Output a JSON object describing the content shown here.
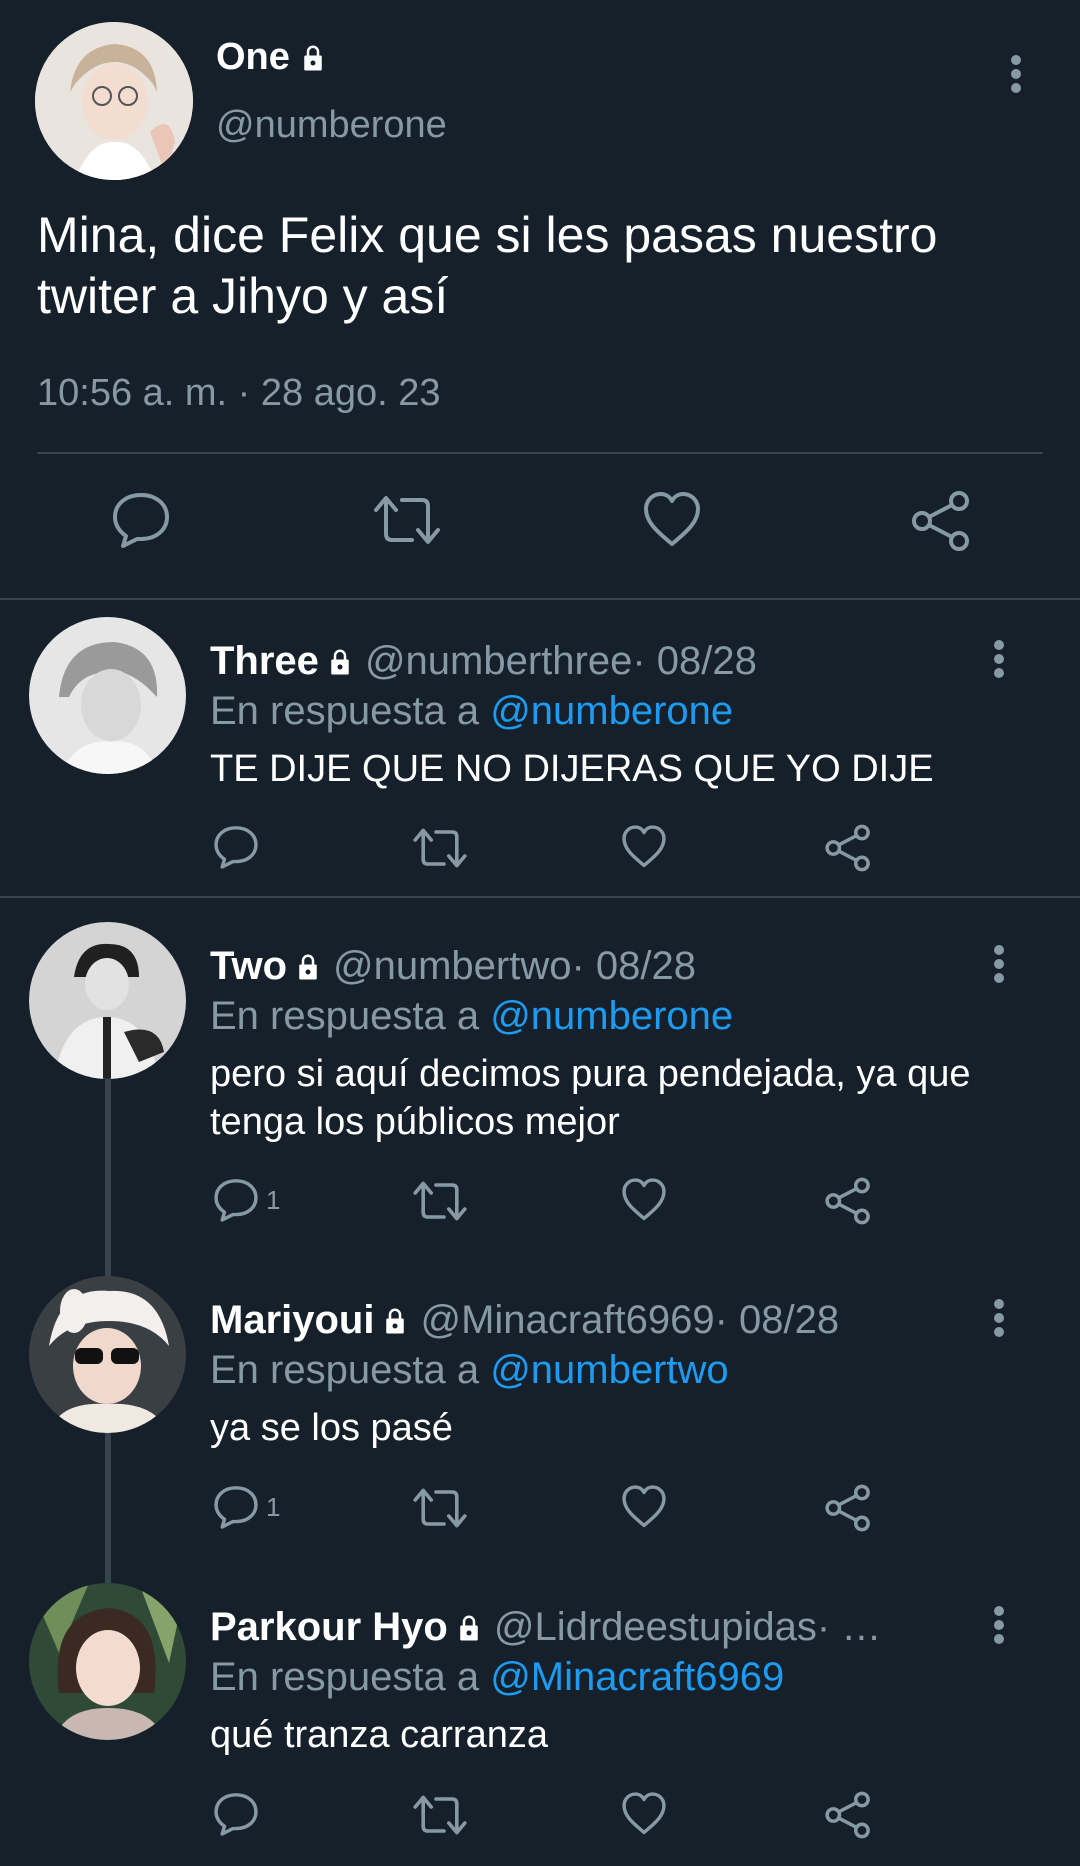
{
  "main_tweet": {
    "name": "One",
    "handle": "@numberone",
    "text": "Mina, dice Felix que si les pasas nuestro twiter a Jihyo y así",
    "timestamp": "10:56 a. m. · 28 ago. 23",
    "icons": {
      "reply": "reply-icon",
      "retweet": "retweet-icon",
      "like": "heart-icon",
      "share": "share-icon"
    }
  },
  "replies": [
    {
      "name": "Three",
      "handle": "@numberthree",
      "date": " · 08/28",
      "in_reply_label": "En respuesta a ",
      "mention": "@numberone",
      "text": "TE DIJE QUE NO DIJERAS QUE YO DIJE",
      "reply_count": ""
    },
    {
      "name": "Two",
      "handle": "@numbertwo",
      "date": " · 08/28",
      "in_reply_label": "En respuesta a ",
      "mention": "@numberone",
      "text": "pero si aquí decimos pura pendejada, ya que tenga los públicos mejor",
      "reply_count": "1"
    },
    {
      "name": "Mariyoui",
      "handle": "@Minacraft6969",
      "date": " · 08/28",
      "in_reply_label": "En respuesta a ",
      "mention": "@numbertwo",
      "text": "ya se los pasé",
      "reply_count": "1"
    },
    {
      "name": "Parkour Hyo",
      "handle": "@Lidrdeestupidas",
      "date": " · …",
      "in_reply_label": "En respuesta a ",
      "mention": "@Minacraft6969",
      "text": "qué tranza carranza",
      "reply_count": ""
    }
  ],
  "colors": {
    "background": "#15202b",
    "muted": "#8899a6",
    "link": "#1d9bf0",
    "divider": "#38444d"
  }
}
